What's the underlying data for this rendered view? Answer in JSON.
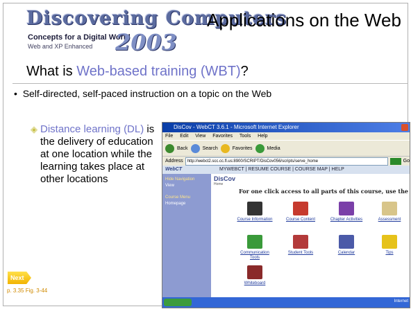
{
  "logo": {
    "brand": "Discovering Computers",
    "year": "2003",
    "tagline": "Concepts for a Digital World",
    "edition": "Web and XP Enhanced"
  },
  "slide": {
    "title": "Applications on the Web",
    "subtitle_prefix": "What is ",
    "subtitle_accent": "Web-based training (WBT)",
    "subtitle_suffix": "?",
    "bullet": "Self-directed, self-paced instruction on a topic on the Web",
    "sub_item_accent": "Distance learning (DL)",
    "sub_item_text": " is the delivery of education at one location while the learning takes place at other locations",
    "next_label": "Next",
    "figure_ref": "p. 3.35 Fig. 3-44"
  },
  "screenshot": {
    "window_title": "DisCov - WebCT 3.6.1 - Microsoft Internet Explorer",
    "menu": [
      "File",
      "Edit",
      "View",
      "Favorites",
      "Tools",
      "Help"
    ],
    "toolbar": [
      "Back",
      "Search",
      "Favorites",
      "Media"
    ],
    "address_label": "Address",
    "address": "http://webct2.scc.cc.fl.us:8900/SCRIPT/DisCov056/scripts/serve_home",
    "go_label": "Go",
    "webct_logo": "WebCT",
    "webct_nav": "MYWEBCT | RESUME COURSE | COURSE MAP | HELP",
    "sidebar": [
      "Hide Navigation",
      "View",
      "Course Menu",
      "Homepage"
    ],
    "course_title": "DisCov",
    "course_sub": "Home",
    "intro": "For one click access to all parts of this course, use the Site Map.",
    "icons": [
      {
        "label": "Course Information",
        "color": "#333333"
      },
      {
        "label": "Course Content",
        "color": "#c63a2e"
      },
      {
        "label": "Chapter Activities",
        "color": "#7a3fa8"
      },
      {
        "label": "Assessment",
        "color": "#d8c58a"
      },
      {
        "label": "Communication Tools",
        "color": "#3a9a3a"
      },
      {
        "label": "Student Tools",
        "color": "#b33a3a"
      },
      {
        "label": "Calendar",
        "color": "#4b5aa8"
      },
      {
        "label": "Tips",
        "color": "#e6c21a"
      },
      {
        "label": "Whiteboard",
        "color": "#8a2a2a"
      }
    ],
    "status_text": "Internet"
  },
  "colors": {
    "accent": "#6f73c9",
    "bullet_diamond": "#c8c14a",
    "next_badge": "#f2b300"
  }
}
